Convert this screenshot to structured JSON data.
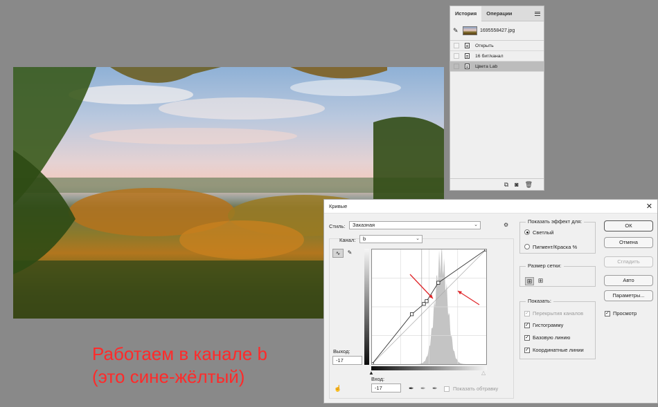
{
  "overlay_text": {
    "line1": "Работаем в канале b",
    "line2": "(это сине-жёлтый)",
    "color": "#ff2a2a"
  },
  "history_panel": {
    "tabs": [
      {
        "label": "История",
        "active": true
      },
      {
        "label": "Операции",
        "active": false
      }
    ],
    "snapshot": {
      "name": "1695558427.jpg"
    },
    "items": [
      {
        "label": "Открыть",
        "selected": false
      },
      {
        "label": "16 бит/канал",
        "selected": false
      },
      {
        "label": "Цвета Lab",
        "selected": true
      }
    ],
    "footer_icons": [
      "new-snapshot-icon",
      "camera-icon",
      "trash-icon"
    ]
  },
  "curves_dialog": {
    "title": "Кривые",
    "style_label": "Стиль:",
    "style_value": "Заказная",
    "channel_label": "Канал:",
    "channel_value": "b",
    "output_label": "Выход:",
    "output_value": "-17",
    "input_label": "Вход:",
    "input_value": "-17",
    "show_clipping": "Показать обтравку",
    "effect_group": {
      "title": "Показать эффект для:",
      "options": [
        {
          "label": "Светлый",
          "checked": true
        },
        {
          "label": "Пигмент/Краска %",
          "checked": false
        }
      ]
    },
    "grid_group": {
      "title": "Размер сетки:"
    },
    "show_group": {
      "title": "Показать:",
      "items": [
        {
          "label": "Перекрытия каналов",
          "checked": true,
          "disabled": true
        },
        {
          "label": "Гистограмму",
          "checked": true,
          "disabled": false
        },
        {
          "label": "Базовую линию",
          "checked": true,
          "disabled": false
        },
        {
          "label": "Координатные линии",
          "checked": true,
          "disabled": false
        }
      ]
    },
    "buttons": {
      "ok": "ОК",
      "cancel": "Отмена",
      "smooth": "Сгладить",
      "auto": "Авто",
      "options": "Параметры..."
    },
    "preview": {
      "label": "Просмотр",
      "checked": true
    },
    "curve_points_in": [
      -128,
      -39,
      -12,
      -6,
      20,
      127
    ],
    "curve_points_out": [
      -128,
      -17,
      6,
      12,
      53,
      127
    ],
    "range": [
      -128,
      127
    ],
    "accent_arrow_color": "#e0262a"
  }
}
